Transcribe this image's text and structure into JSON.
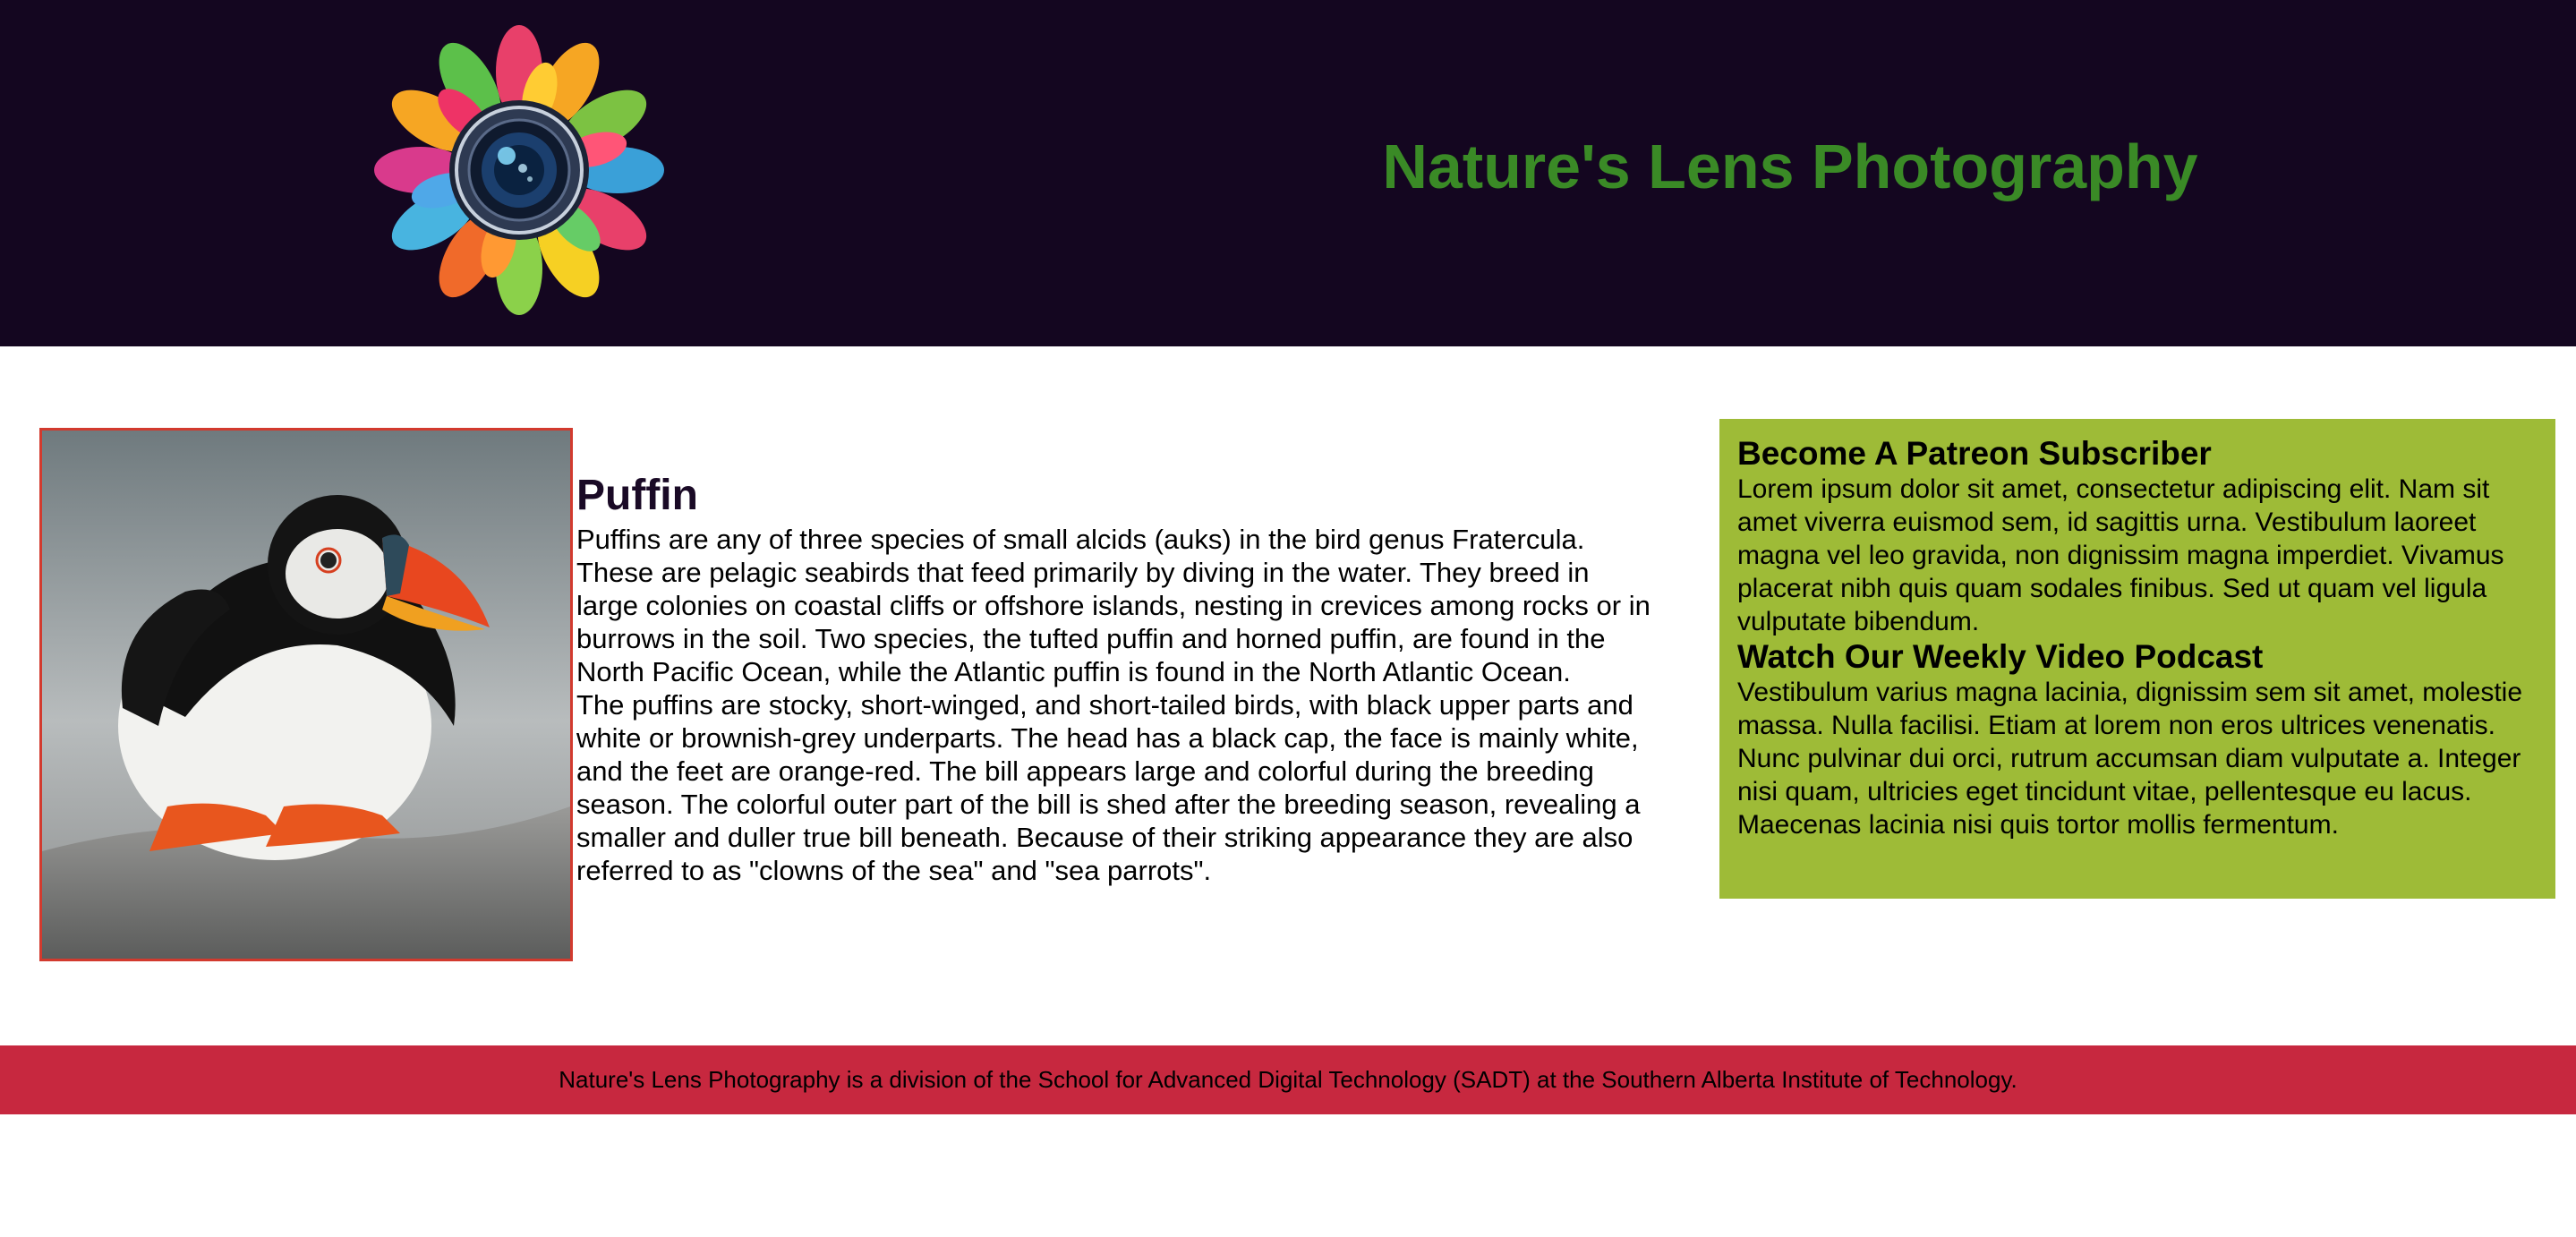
{
  "header": {
    "logo_alt": "camera lens floral logo",
    "title": "Nature's Lens Photography",
    "background": "#140620",
    "title_color": "#3a8a26"
  },
  "article": {
    "image_alt": "puffin photo",
    "title": "Puffin",
    "paragraphs": [
      "Puffins are any of three species of small alcids (auks) in the bird genus Fratercula. These are pelagic seabirds that feed primarily by diving in the water. They breed in large colonies on coastal cliffs or offshore islands, nesting in crevices among rocks or in burrows in the soil. Two species, the tufted puffin and horned puffin, are found in the North Pacific Ocean, while the Atlantic puffin is found in the North Atlantic Ocean.",
      "The puffins are stocky, short-winged, and short-tailed birds, with black upper parts and white or brownish-grey underparts. The head has a black cap, the face is mainly white, and the feet are orange-red. The bill appears large and colorful during the breeding season. The colorful outer part of the bill is shed after the breeding season, revealing a smaller and duller true bill beneath. Because of their striking appearance they are also referred to as \"clowns of the sea\" and \"sea parrots\"."
    ]
  },
  "sidebar": {
    "background": "#9ebb37",
    "sections": [
      {
        "heading": "Become A Patreon Subscriber",
        "text": "Lorem ipsum dolor sit amet, consectetur adipiscing elit. Nam sit amet viverra euismod sem, id sagittis urna. Vestibulum laoreet magna vel leo gravida, non dignissim magna imperdiet. Vivamus placerat nibh quis quam sodales finibus. Sed ut quam vel ligula vulputate bibendum."
      },
      {
        "heading": "Watch Our Weekly Video Podcast",
        "text": "Vestibulum varius magna lacinia, dignissim sem sit amet, molestie massa. Nulla facilisi. Etiam at lorem non eros ultrices venenatis. Nunc pulvinar dui orci, rutrum accumsan diam vulputate a. Integer nisi quam, ultricies eget tincidunt vitae, pellentesque eu lacus. Maecenas lacinia nisi quis tortor mollis fermentum."
      }
    ]
  },
  "footer": {
    "text": "Nature's Lens Photography is a division of the School for Advanced Digital Technology (SADT) at the Southern Alberta Institute of Technology.",
    "background": "#c7283f"
  }
}
